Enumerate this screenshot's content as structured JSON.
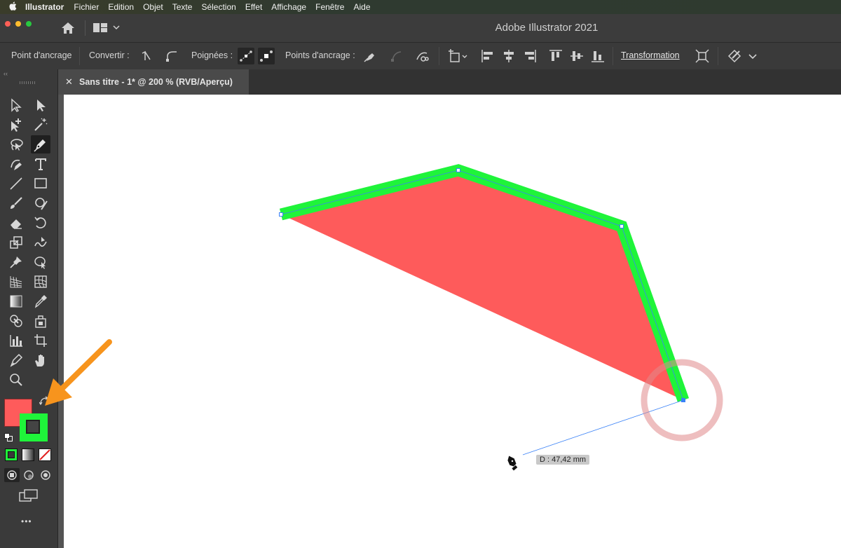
{
  "menubar": {
    "apple": "",
    "app": "Illustrator",
    "items": [
      "Fichier",
      "Edition",
      "Objet",
      "Texte",
      "Sélection",
      "Effet",
      "Affichage",
      "Fenêtre",
      "Aide"
    ]
  },
  "window": {
    "title": "Adobe Illustrator 2021"
  },
  "control_bar": {
    "context": "Point d'ancrage",
    "convert_label": "Convertir :",
    "handles_label": "Poignées :",
    "anchors_label": "Points d'ancrage :",
    "transform_label": "Transformation"
  },
  "document": {
    "tab_close": "✕",
    "tab_title": "Sans titre - 1* @ 200 % (RVB/Aperçu)"
  },
  "canvas": {
    "measure_label": "D : 47,42 mm"
  },
  "colors": {
    "fill": "#fe5b5b",
    "stroke": "#1ff43a",
    "annotation_arrow": "#f7941d",
    "click_circle": "#e8a8a8",
    "path_outline": "#3a82f7"
  },
  "toolbar": {
    "more": "•••"
  }
}
